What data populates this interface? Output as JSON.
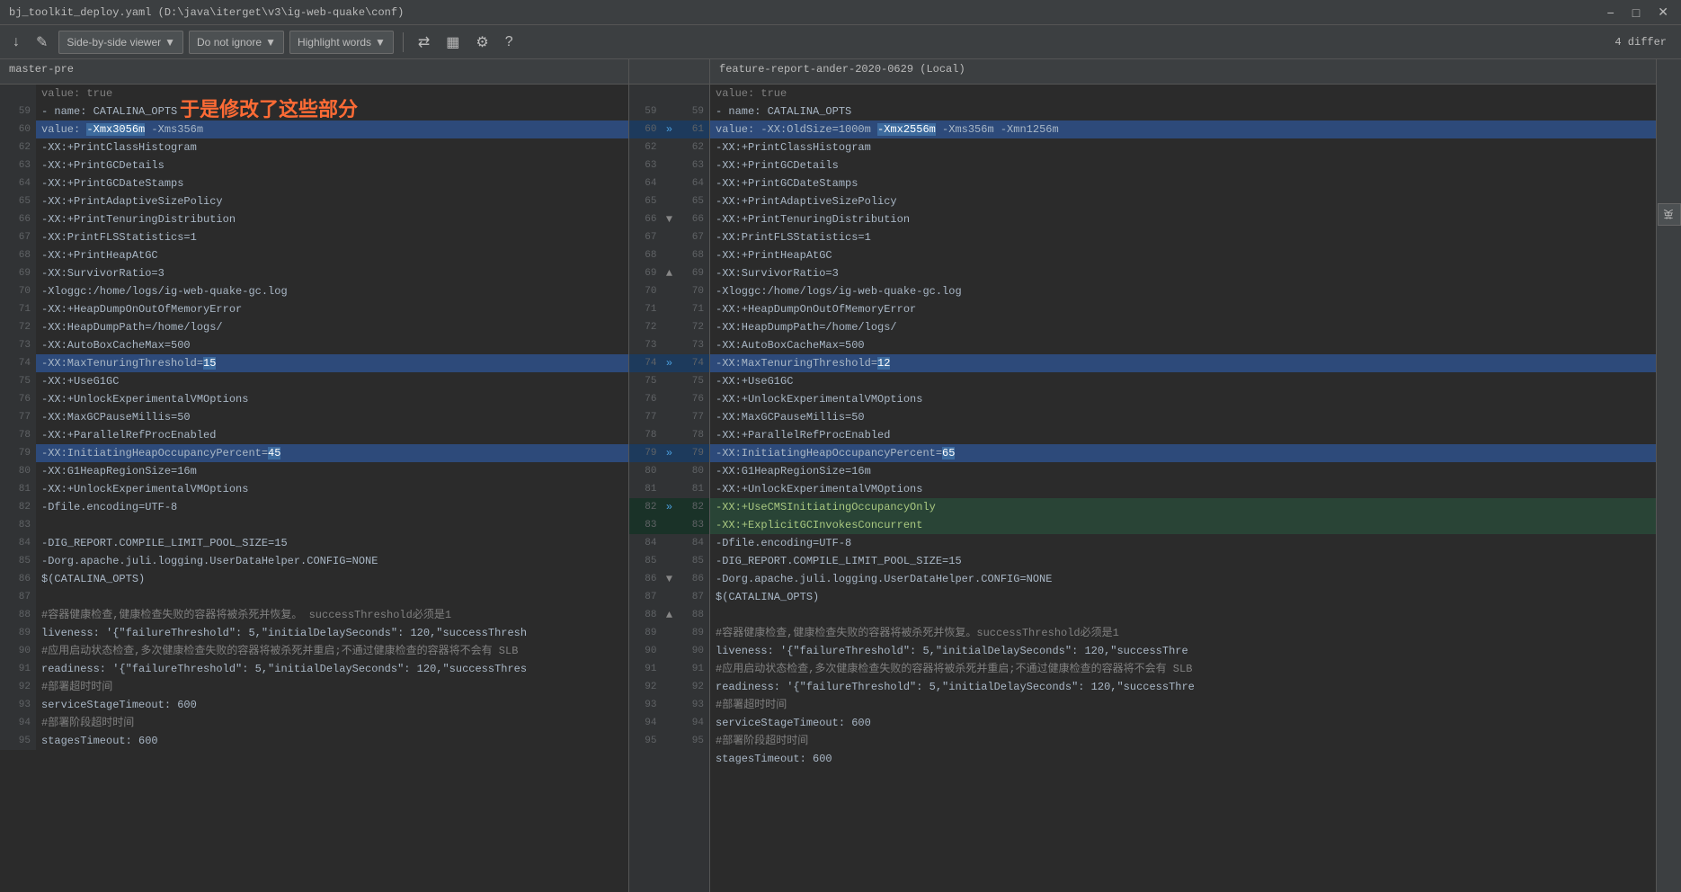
{
  "titleBar": {
    "title": "bj_toolkit_deploy.yaml (D:\\java\\iterget\\v3\\ig-web-quake\\conf)",
    "controls": [
      "minimize",
      "restore",
      "close"
    ]
  },
  "toolbar": {
    "downArrow": "↓",
    "editIcon": "✏",
    "viewerLabel": "Side-by-side viewer",
    "ignoreLabel": "Do not ignore",
    "highlightLabel": "Highlight words",
    "settingsIcon": "⚙",
    "helpIcon": "?",
    "diffCount": "4 differ"
  },
  "branches": {
    "left": "master-pre",
    "right": "feature-report-ander-2020-0629 (Local)"
  },
  "annotation": "于是修改了这些部分",
  "lines": [
    {
      "leftNum": "",
      "rightNumL": "",
      "rightNumR": "",
      "leftContent": "  value: true",
      "rightContent": "  value: true",
      "type": "normal"
    },
    {
      "leftNum": "59",
      "rightNumL": "59",
      "rightNumR": "",
      "leftContent": "  - name: CATALINA_OPTS",
      "rightContent": "  - name: CATALINA_OPTS",
      "type": "normal"
    },
    {
      "leftNum": "60",
      "rightNumL": "60",
      "rightNumR": "61",
      "leftContent": "    value: -Xmx3056m -Xms356m",
      "rightContent": "    value: -XX:OldSize=1000m -Xmx2556m -Xms356m -Xmn1256m",
      "type": "changed",
      "arrow": "»"
    },
    {
      "leftNum": "62",
      "rightNumL": "62",
      "rightNumR": "62",
      "leftContent": "    -XX:+PrintClassHistogram",
      "rightContent": "    -XX:+PrintClassHistogram",
      "type": "normal"
    },
    {
      "leftNum": "63",
      "rightNumL": "63",
      "rightNumR": "63",
      "leftContent": "    -XX:+PrintGCDetails",
      "rightContent": "    -XX:+PrintGCDetails",
      "type": "normal"
    },
    {
      "leftNum": "64",
      "rightNumL": "64",
      "rightNumR": "64",
      "leftContent": "    -XX:+PrintGCDateStamps",
      "rightContent": "    -XX:+PrintGCDateStamps",
      "type": "normal"
    },
    {
      "leftNum": "65",
      "rightNumL": "65",
      "rightNumR": "65",
      "leftContent": "    -XX:+PrintAdaptiveSizePolicy",
      "rightContent": "    -XX:+PrintAdaptiveSizePolicy",
      "type": "normal"
    },
    {
      "leftNum": "66",
      "rightNumL": "66",
      "rightNumR": "66",
      "leftContent": "    -XX:+PrintTenuringDistribution",
      "rightContent": "    -XX:+PrintTenuringDistribution",
      "type": "normal"
    },
    {
      "leftNum": "67",
      "rightNumL": "67",
      "rightNumR": "67",
      "leftContent": "    -XX:PrintFLSStatistics=1",
      "rightContent": "    -XX:PrintFLSStatistics=1",
      "type": "normal"
    },
    {
      "leftNum": "68",
      "rightNumL": "68",
      "rightNumR": "68",
      "leftContent": "    -XX:+PrintHeapAtGC",
      "rightContent": "    -XX:+PrintHeapAtGC",
      "type": "normal"
    },
    {
      "leftNum": "69",
      "rightNumL": "69",
      "rightNumR": "69",
      "leftContent": "    -XX:SurvivorRatio=3",
      "rightContent": "    -XX:SurvivorRatio=3",
      "type": "normal"
    },
    {
      "leftNum": "70",
      "rightNumL": "70",
      "rightNumR": "70",
      "leftContent": "    -Xloggc:/home/logs/ig-web-quake-gc.log",
      "rightContent": "    -Xloggc:/home/logs/ig-web-quake-gc.log",
      "type": "normal"
    },
    {
      "leftNum": "71",
      "rightNumL": "71",
      "rightNumR": "71",
      "leftContent": "    -XX:+HeapDumpOnOutOfMemoryError",
      "rightContent": "    -XX:+HeapDumpOnOutOfMemoryError",
      "type": "normal"
    },
    {
      "leftNum": "72",
      "rightNumL": "72",
      "rightNumR": "72",
      "leftContent": "    -XX:HeapDumpPath=/home/logs/",
      "rightContent": "    -XX:HeapDumpPath=/home/logs/",
      "type": "normal"
    },
    {
      "leftNum": "73",
      "rightNumL": "73",
      "rightNumR": "73",
      "leftContent": "    -XX:AutoBoxCacheMax=500",
      "rightContent": "    -XX:AutoBoxCacheMax=500",
      "type": "normal"
    },
    {
      "leftNum": "74",
      "rightNumL": "74",
      "rightNumR": "74",
      "leftContent": "    -XX:MaxTenuringThreshold=15",
      "rightContent": "    -XX:MaxTenuringThreshold=12",
      "type": "changed",
      "arrow": "»"
    },
    {
      "leftNum": "75",
      "rightNumL": "75",
      "rightNumR": "75",
      "leftContent": "    -XX:+UseG1GC",
      "rightContent": "    -XX:+UseG1GC",
      "type": "normal"
    },
    {
      "leftNum": "76",
      "rightNumL": "76",
      "rightNumR": "76",
      "leftContent": "    -XX:+UnlockExperimentalVMOptions",
      "rightContent": "    -XX:+UnlockExperimentalVMOptions",
      "type": "normal"
    },
    {
      "leftNum": "77",
      "rightNumL": "77",
      "rightNumR": "77",
      "leftContent": "    -XX:MaxGCPauseMillis=50",
      "rightContent": "    -XX:MaxGCPauseMillis=50",
      "type": "normal"
    },
    {
      "leftNum": "78",
      "rightNumL": "78",
      "rightNumR": "78",
      "leftContent": "    -XX:+ParallelRefProcEnabled",
      "rightContent": "    -XX:+ParallelRefProcEnabled",
      "type": "normal"
    },
    {
      "leftNum": "79",
      "rightNumL": "79",
      "rightNumR": "79",
      "leftContent": "    -XX:InitiatingHeapOccupancyPercent=45",
      "rightContent": "    -XX:InitiatingHeapOccupancyPercent=65",
      "type": "changed",
      "arrow": "»"
    },
    {
      "leftNum": "80",
      "rightNumL": "80",
      "rightNumR": "80",
      "leftContent": "    -XX:G1HeapRegionSize=16m",
      "rightContent": "    -XX:G1HeapRegionSize=16m",
      "type": "normal"
    },
    {
      "leftNum": "81",
      "rightNumL": "81",
      "rightNumR": "81",
      "leftContent": "    -XX:+UnlockExperimentalVMOptions",
      "rightContent": "    -XX:+UnlockExperimentalVMOptions",
      "type": "normal"
    },
    {
      "leftNum": "82",
      "rightNumL": "82",
      "rightNumR": "82",
      "leftContent": "    -Dfile.encoding=UTF-8",
      "rightContent": "    -XX:+UseCMSInitiatingOccupancyOnly",
      "type": "added-right",
      "arrow": "»"
    },
    {
      "leftNum": "83",
      "rightNumL": "83",
      "rightNumR": "83",
      "leftContent": "",
      "rightContent": "    -XX:+ExplicitGCInvokesConcurrent",
      "type": "added-right-2"
    },
    {
      "leftNum": "84",
      "rightNumL": "84",
      "rightNumR": "84",
      "leftContent": "    -DIG_REPORT.COMPILE_LIMIT_POOL_SIZE=15",
      "rightContent": "    -Dfile.encoding=UTF-8",
      "type": "normal"
    },
    {
      "leftNum": "85",
      "rightNumL": "85",
      "rightNumR": "85",
      "leftContent": "    -Dorg.apache.juli.logging.UserDataHelper.CONFIG=NONE",
      "rightContent": "    -DIG_REPORT.COMPILE_LIMIT_POOL_SIZE=15",
      "type": "normal"
    },
    {
      "leftNum": "86",
      "rightNumL": "86",
      "rightNumR": "86",
      "leftContent": "    $(CATALINA_OPTS)",
      "rightContent": "    -Dorg.apache.juli.logging.UserDataHelper.CONFIG=NONE",
      "type": "normal"
    },
    {
      "leftNum": "87",
      "rightNumL": "87",
      "rightNumR": "87",
      "leftContent": "",
      "rightContent": "    $(CATALINA_OPTS)",
      "type": "normal"
    },
    {
      "leftNum": "88",
      "rightNumL": "88",
      "rightNumR": "88",
      "leftContent": "#容器健康检查,健康检查失败的容器将被杀死并恢复。successThreshold必须是1",
      "rightContent": "#容器健康检查,健康检查失败的容器将被杀死并恢复。successThreshold必须是1",
      "type": "comment"
    },
    {
      "leftNum": "89",
      "rightNumL": "89",
      "rightNumR": "89",
      "leftContent": "liveness: '{\"failureThreshold\": 5,\"initialDelaySeconds\": 120,\"successThresh",
      "rightContent": "liveness: '{\"failureThreshold\": 5,\"initialDelaySeconds\": 120,\"successThre",
      "type": "normal"
    },
    {
      "leftNum": "90",
      "rightNumL": "90",
      "rightNumR": "90",
      "leftContent": "#应用启动状态检查,多次健康检查失败的容器将被杀死并重启;不通过健康检查的容器将不会有 SLB",
      "rightContent": "#应用启动状态检查,多次健康检查失败的容器将被杀死并重启;不通过健康检查的容器将不会有 SLB",
      "type": "comment"
    },
    {
      "leftNum": "91",
      "rightNumL": "91",
      "rightNumR": "91",
      "leftContent": "readiness: '{\"failureThreshold\": 5,\"initialDelaySeconds\": 120,\"successThres",
      "rightContent": "readiness: '{\"failureThreshold\": 5,\"initialDelaySeconds\": 120,\"successThre",
      "type": "normal"
    },
    {
      "leftNum": "92",
      "rightNumL": "92",
      "rightNumR": "92",
      "leftContent": "#部署超时时间",
      "rightContent": "#部署超时时间",
      "type": "comment"
    },
    {
      "leftNum": "93",
      "rightNumL": "93",
      "rightNumR": "93",
      "leftContent": "serviceStageTimeout: 600",
      "rightContent": "serviceStageTimeout: 600",
      "type": "normal"
    },
    {
      "leftNum": "94",
      "rightNumL": "94",
      "rightNumR": "94",
      "leftContent": "#部署阶段超时时间",
      "rightContent": "#部署阶段超时时间",
      "type": "comment"
    },
    {
      "leftNum": "95",
      "rightNumL": "95",
      "rightNumR": "95",
      "leftContent": "stagesTimeout: 600",
      "rightContent": "stagesTimeout: 600",
      "type": "normal"
    }
  ],
  "sidePanel": {
    "label": "英"
  }
}
